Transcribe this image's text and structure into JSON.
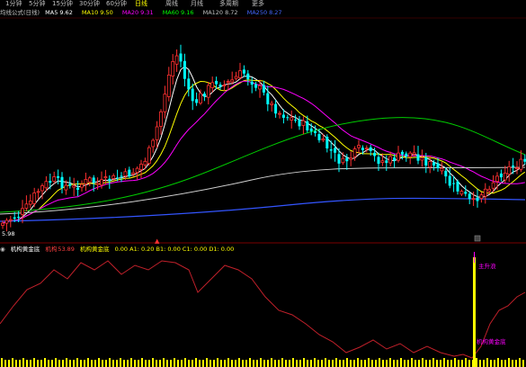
{
  "periods": [
    {
      "label": "1分钟"
    },
    {
      "label": "5分钟"
    },
    {
      "label": "15分钟"
    },
    {
      "label": "30分钟"
    },
    {
      "label": "60分钟"
    },
    {
      "label": "日线",
      "active": true
    },
    {
      "label": "周线"
    },
    {
      "label": "月线"
    },
    {
      "label": "多周期"
    },
    {
      "label": "更多"
    }
  ],
  "ma_header": {
    "title": "均线公式(日线)",
    "items": [
      {
        "label": "MA5",
        "value": "9.62",
        "color": "#ffffff"
      },
      {
        "label": "MA10",
        "value": "9.50",
        "color": "#ffff00"
      },
      {
        "label": "MA20",
        "value": "9.31",
        "color": "#ff00ff"
      },
      {
        "label": "MA60",
        "value": "9.16",
        "color": "#00ff00"
      },
      {
        "label": "MA120",
        "value": "8.72",
        "color": "#c0c0c0"
      },
      {
        "label": "MA250",
        "value": "8.27",
        "color": "#4466ff"
      }
    ]
  },
  "price_labels": {
    "low_mark": "5.98"
  },
  "indicator": {
    "name": "机构黄金底",
    "params": "机构",
    "value": "53.89",
    "line_label": "机构黄金底",
    "fields": "0.00 A1: 0.20 B1: 0.00 C1: 0.00 D1: 0.00"
  },
  "markers": {
    "signal_top": "主升浪",
    "signal_bottom": "机构黄金底"
  },
  "colors": {
    "up": "#ff3030",
    "down": "#00ffff",
    "ma5": "#ffffff",
    "ma10": "#ffff00",
    "ma20": "#ff00ff",
    "ma60": "#00cc00",
    "ma120": "#d0d0d0",
    "ma250": "#3355ff",
    "indicator_line": "#c0202a",
    "indicator_bar": "#ffff00",
    "signal_label": "#ff00ff"
  }
}
